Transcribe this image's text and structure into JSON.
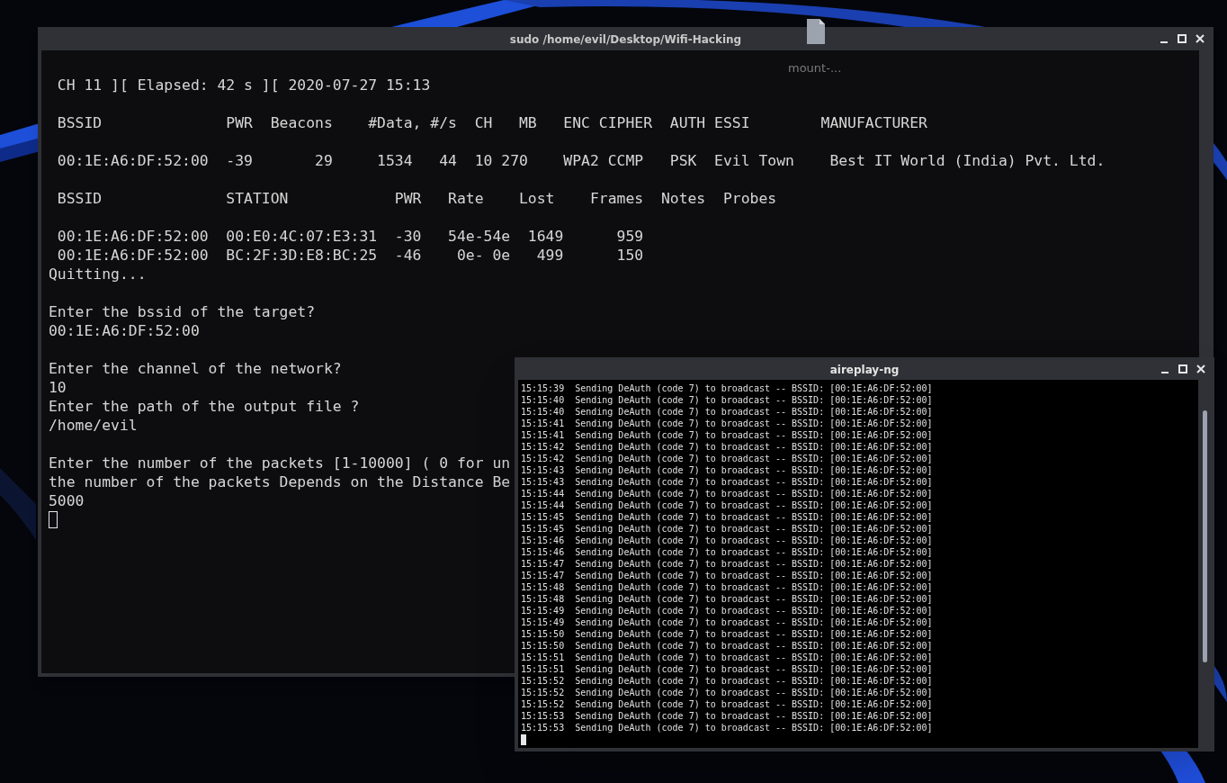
{
  "desktop_icon": {
    "label": "mount-..."
  },
  "main_window": {
    "title": "sudo /home/evil/Desktop/Wifi-Hacking",
    "lines": [
      {
        "kind": "text",
        "text": " CH 11 ][ Elapsed: 42 s ][ 2020-07-27 15:13"
      },
      {
        "kind": "blank"
      },
      {
        "kind": "text",
        "text": " BSSID              PWR  Beacons    #Data, #/s  CH   MB   ENC CIPHER  AUTH ESSI        MANUFACTURER"
      },
      {
        "kind": "blank"
      },
      {
        "kind": "text",
        "text": " 00:1E:A6:DF:52:00  -39       29     1534   44  10 270    WPA2 CCMP   PSK  Evil Town    Best IT World (India) Pvt. Ltd."
      },
      {
        "kind": "blank"
      },
      {
        "kind": "text",
        "text": " BSSID              STATION            PWR   Rate    Lost    Frames  Notes  Probes"
      },
      {
        "kind": "blank"
      },
      {
        "kind": "text",
        "text": " 00:1E:A6:DF:52:00  00:E0:4C:07:E3:31  -30   54e-54e  1649      959"
      },
      {
        "kind": "text",
        "text": " 00:1E:A6:DF:52:00  BC:2F:3D:E8:BC:25  -46    0e- 0e   499      150"
      },
      {
        "kind": "text",
        "text": "Quitting..."
      },
      {
        "kind": "blank"
      },
      {
        "kind": "text",
        "text": "Enter the bssid of the target?"
      },
      {
        "kind": "text",
        "text": "00:1E:A6:DF:52:00"
      },
      {
        "kind": "blank"
      },
      {
        "kind": "text",
        "text": "Enter the channel of the network?"
      },
      {
        "kind": "text",
        "text": "10"
      },
      {
        "kind": "text",
        "text": "Enter the path of the output file ?"
      },
      {
        "kind": "text",
        "text": "/home/evil"
      },
      {
        "kind": "blank"
      },
      {
        "kind": "text",
        "text": "Enter the number of the packets [1-10000] ( 0 for un"
      },
      {
        "kind": "text",
        "text": "the number of the packets Depends on the Distance Be"
      },
      {
        "kind": "text",
        "text": "5000"
      },
      {
        "kind": "cursor"
      }
    ]
  },
  "aireplay_window": {
    "title": "aireplay-ng",
    "lines": [
      {
        "kind": "text",
        "text": "15:15:39  Sending DeAuth (code 7) to broadcast -- BSSID: [00:1E:A6:DF:52:00]"
      },
      {
        "kind": "text",
        "text": "15:15:40  Sending DeAuth (code 7) to broadcast -- BSSID: [00:1E:A6:DF:52:00]"
      },
      {
        "kind": "text",
        "text": "15:15:40  Sending DeAuth (code 7) to broadcast -- BSSID: [00:1E:A6:DF:52:00]"
      },
      {
        "kind": "text",
        "text": "15:15:41  Sending DeAuth (code 7) to broadcast -- BSSID: [00:1E:A6:DF:52:00]"
      },
      {
        "kind": "text",
        "text": "15:15:41  Sending DeAuth (code 7) to broadcast -- BSSID: [00:1E:A6:DF:52:00]"
      },
      {
        "kind": "text",
        "text": "15:15:42  Sending DeAuth (code 7) to broadcast -- BSSID: [00:1E:A6:DF:52:00]"
      },
      {
        "kind": "text",
        "text": "15:15:42  Sending DeAuth (code 7) to broadcast -- BSSID: [00:1E:A6:DF:52:00]"
      },
      {
        "kind": "text",
        "text": "15:15:43  Sending DeAuth (code 7) to broadcast -- BSSID: [00:1E:A6:DF:52:00]"
      },
      {
        "kind": "text",
        "text": "15:15:43  Sending DeAuth (code 7) to broadcast -- BSSID: [00:1E:A6:DF:52:00]"
      },
      {
        "kind": "text",
        "text": "15:15:44  Sending DeAuth (code 7) to broadcast -- BSSID: [00:1E:A6:DF:52:00]"
      },
      {
        "kind": "text",
        "text": "15:15:44  Sending DeAuth (code 7) to broadcast -- BSSID: [00:1E:A6:DF:52:00]"
      },
      {
        "kind": "text",
        "text": "15:15:45  Sending DeAuth (code 7) to broadcast -- BSSID: [00:1E:A6:DF:52:00]"
      },
      {
        "kind": "text",
        "text": "15:15:45  Sending DeAuth (code 7) to broadcast -- BSSID: [00:1E:A6:DF:52:00]"
      },
      {
        "kind": "text",
        "text": "15:15:46  Sending DeAuth (code 7) to broadcast -- BSSID: [00:1E:A6:DF:52:00]"
      },
      {
        "kind": "text",
        "text": "15:15:46  Sending DeAuth (code 7) to broadcast -- BSSID: [00:1E:A6:DF:52:00]"
      },
      {
        "kind": "text",
        "text": "15:15:47  Sending DeAuth (code 7) to broadcast -- BSSID: [00:1E:A6:DF:52:00]"
      },
      {
        "kind": "text",
        "text": "15:15:47  Sending DeAuth (code 7) to broadcast -- BSSID: [00:1E:A6:DF:52:00]"
      },
      {
        "kind": "text",
        "text": "15:15:48  Sending DeAuth (code 7) to broadcast -- BSSID: [00:1E:A6:DF:52:00]"
      },
      {
        "kind": "text",
        "text": "15:15:48  Sending DeAuth (code 7) to broadcast -- BSSID: [00:1E:A6:DF:52:00]"
      },
      {
        "kind": "text",
        "text": "15:15:49  Sending DeAuth (code 7) to broadcast -- BSSID: [00:1E:A6:DF:52:00]"
      },
      {
        "kind": "text",
        "text": "15:15:49  Sending DeAuth (code 7) to broadcast -- BSSID: [00:1E:A6:DF:52:00]"
      },
      {
        "kind": "text",
        "text": "15:15:50  Sending DeAuth (code 7) to broadcast -- BSSID: [00:1E:A6:DF:52:00]"
      },
      {
        "kind": "text",
        "text": "15:15:50  Sending DeAuth (code 7) to broadcast -- BSSID: [00:1E:A6:DF:52:00]"
      },
      {
        "kind": "text",
        "text": "15:15:51  Sending DeAuth (code 7) to broadcast -- BSSID: [00:1E:A6:DF:52:00]"
      },
      {
        "kind": "text",
        "text": "15:15:51  Sending DeAuth (code 7) to broadcast -- BSSID: [00:1E:A6:DF:52:00]"
      },
      {
        "kind": "text",
        "text": "15:15:52  Sending DeAuth (code 7) to broadcast -- BSSID: [00:1E:A6:DF:52:00]"
      },
      {
        "kind": "text",
        "text": "15:15:52  Sending DeAuth (code 7) to broadcast -- BSSID: [00:1E:A6:DF:52:00]"
      },
      {
        "kind": "text",
        "text": "15:15:52  Sending DeAuth (code 7) to broadcast -- BSSID: [00:1E:A6:DF:52:00]"
      },
      {
        "kind": "text",
        "text": "15:15:53  Sending DeAuth (code 7) to broadcast -- BSSID: [00:1E:A6:DF:52:00]"
      },
      {
        "kind": "text",
        "text": "15:15:53  Sending DeAuth (code 7) to broadcast -- BSSID: [00:1E:A6:DF:52:00]"
      },
      {
        "kind": "cursor"
      }
    ]
  }
}
